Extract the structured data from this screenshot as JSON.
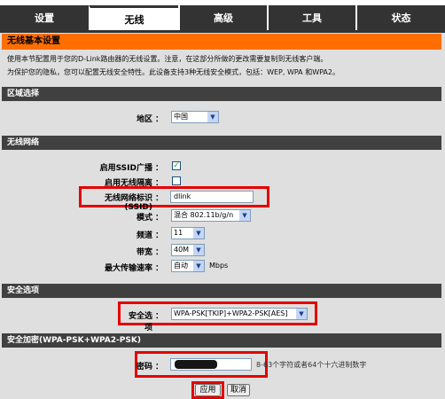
{
  "tabs": [
    {
      "label": "设置",
      "active": false
    },
    {
      "label": "无线",
      "active": true
    },
    {
      "label": "高级",
      "active": false
    },
    {
      "label": "工具",
      "active": false
    },
    {
      "label": "状态",
      "active": false
    }
  ],
  "page": {
    "title": "无线基本设置",
    "intro_line1": "使用本节配置用于您的D-Link路由器的无线设置。注意，在这部分所做的更改需要复制到无线客户端。",
    "intro_line2": "为保护您的隐私，您可以配置无线安全特性。此设备支持3种无线安全模式，包括：WEP, WPA 和WPA2。"
  },
  "region": {
    "header": "区域选择",
    "label": "地区",
    "value": "中国"
  },
  "wireless": {
    "header": "无线网络",
    "ssid_broadcast_label": "启用SSID广播",
    "ssid_broadcast_checked": "✓",
    "isolation_label": "启用无线隔离",
    "isolation_checked": "",
    "ssid_label": "无线网络标识(SSID)",
    "ssid_value": "dlink",
    "mode_label": "模式",
    "mode_value": "混合 802.11b/g/n",
    "channel_label": "频道",
    "channel_value": "11",
    "bandwidth_label": "带宽",
    "bandwidth_value": "40M",
    "max_rate_label": "最大传输速率",
    "max_rate_value": "自动",
    "max_rate_unit": "Mbps"
  },
  "security": {
    "header": "安全选项",
    "label": "安全选项",
    "value": "WPA-PSK[TKIP]+WPA2-PSK[AES]"
  },
  "encryption": {
    "header": "安全加密(WPA-PSK+WPA2-PSK)",
    "password_label": "密码",
    "password_hint": "8-63个字符或者64个十六进制数字"
  },
  "buttons": {
    "apply": "应用",
    "cancel": "取消"
  },
  "symbols": {
    "colon": "：",
    "arrow": "▼"
  },
  "colors": {
    "accent": "#ff6f00",
    "tab_bg": "#333333",
    "section_header": "#404040",
    "panel_bg": "#dfdfdf",
    "highlight_red": "#e50000"
  }
}
